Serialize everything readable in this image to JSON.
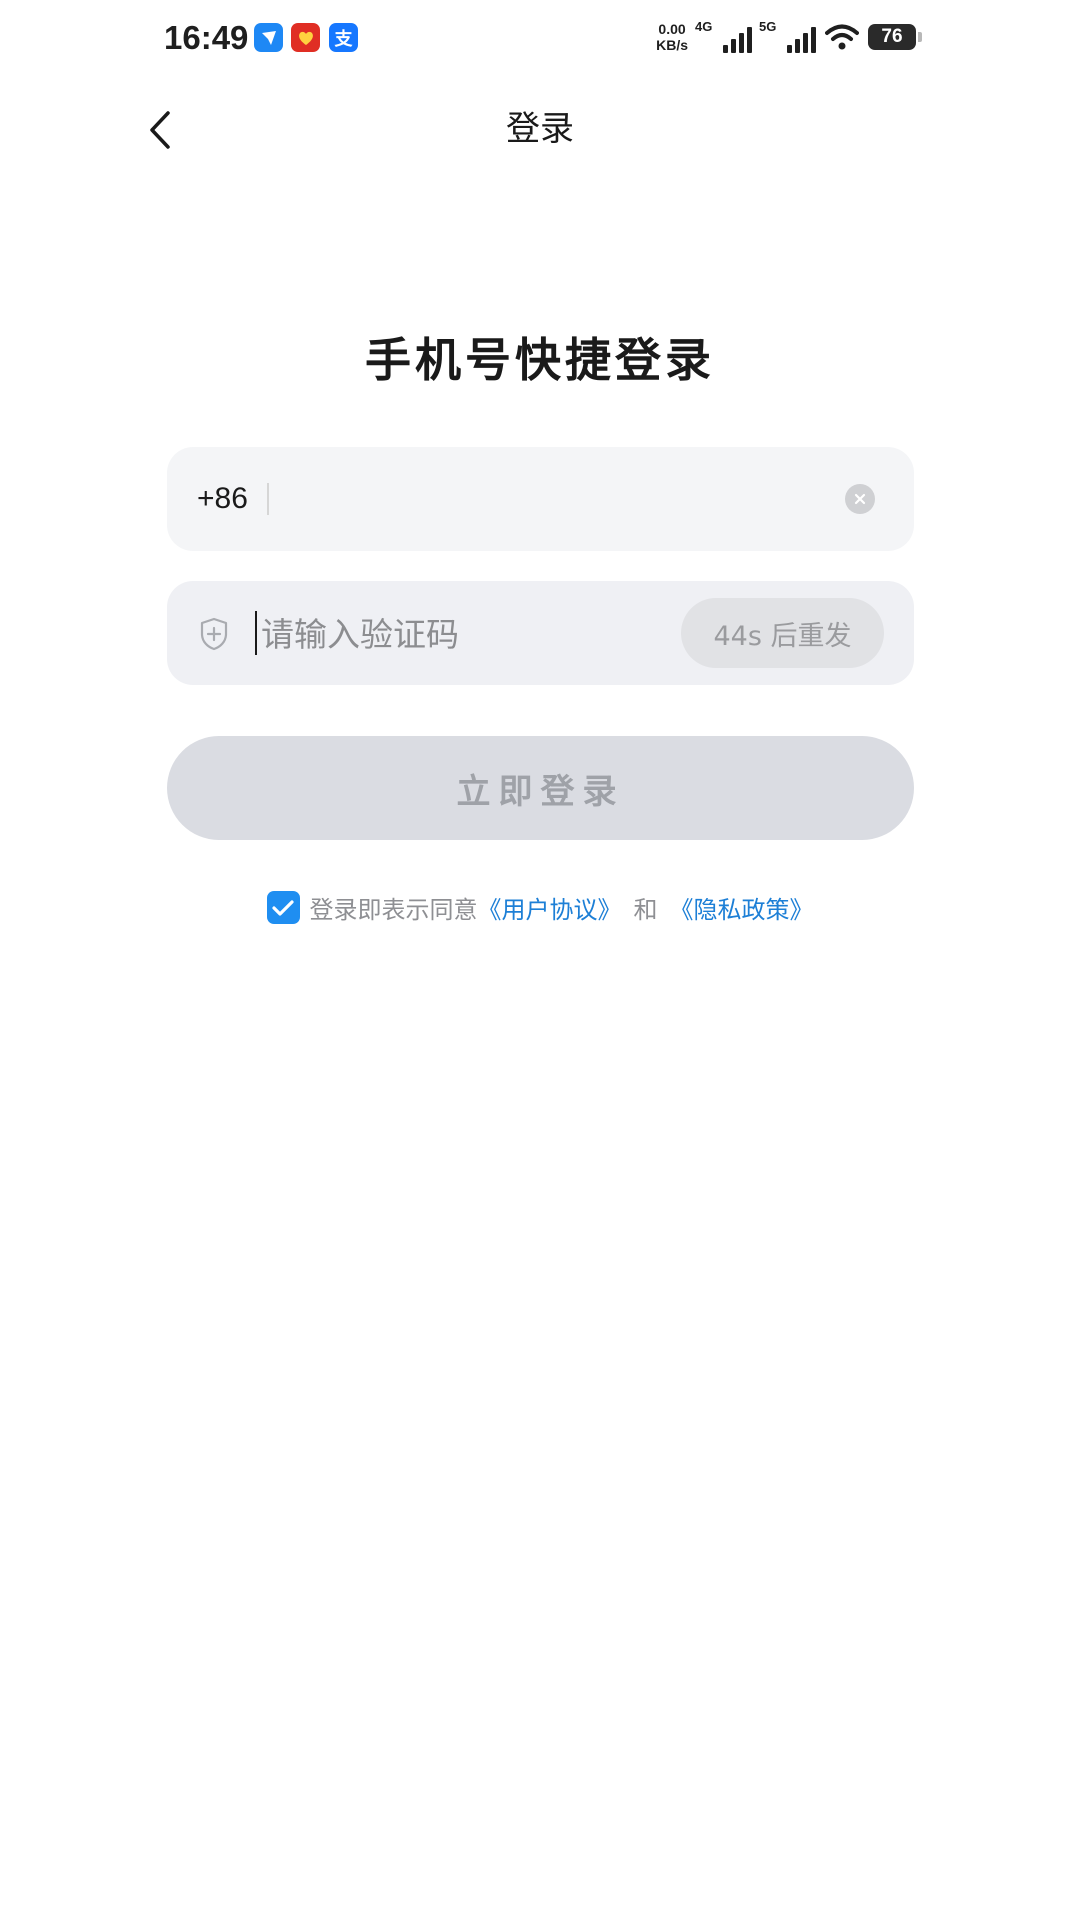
{
  "status_bar": {
    "time": "16:49",
    "app_icons": [
      {
        "name": "feishu-app-icon",
        "color": "#1e88f5",
        "glyph": "✈"
      },
      {
        "name": "pinduoduo-app-icon",
        "color": "#e02e24",
        "glyph": "❤"
      },
      {
        "name": "alipay-app-icon",
        "color": "#1677ff",
        "glyph": "支"
      }
    ],
    "net_speed_value": "0.00",
    "net_speed_unit": "KB/s",
    "signal_1_label": "4G",
    "signal_2_label": "5G",
    "battery": "76"
  },
  "nav": {
    "title": "登录",
    "back_icon": "chevron-left-icon"
  },
  "heading": "手机号快捷登录",
  "phone_field": {
    "country_code": "+86",
    "value": "",
    "clear_icon": "clear-circle-icon"
  },
  "code_field": {
    "placeholder": "请输入验证码",
    "value": "",
    "shield_icon": "shield-plus-icon",
    "resend_label": "44s 后重发"
  },
  "login_button": "立即登录",
  "agreement": {
    "checked": true,
    "prefix": "登录即表示同意",
    "user_agreement": "《用户协议》",
    "and": "和",
    "privacy_policy": "《隐私政策》"
  },
  "colors": {
    "accent": "#1f8ef1",
    "link": "#1d7fd6",
    "field_bg": "#f4f5f7",
    "button_disabled_bg": "#dadce2"
  }
}
